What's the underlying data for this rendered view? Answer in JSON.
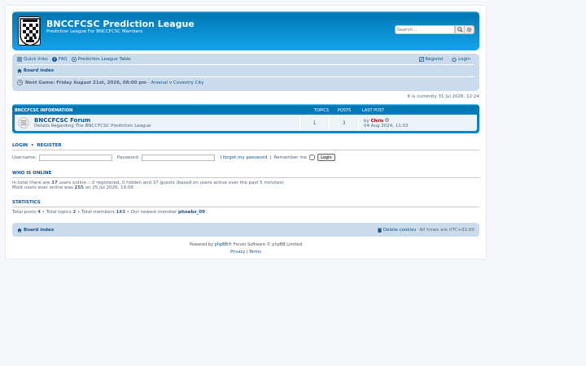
{
  "header": {
    "site_title": "BNCCFCSC Prediction League",
    "site_description": "Prediction League For BNCCFCSC Members",
    "search_placeholder": "Search…"
  },
  "nav": {
    "quick_links": "Quick links",
    "faq": "FAQ",
    "league_table": "Prediction League Table",
    "register": "Register",
    "login": "Login",
    "board_index": "Board index",
    "next_game_label": "Next Game: Friday August 21st, 2026, 08:00 pm",
    "next_game_sep": " - ",
    "next_game_match": "Arsenal v Coventry City"
  },
  "time_line": "It is currently 31 Jul 2026, 12:24",
  "forum_table": {
    "headers": [
      "BNCCFCSC INFORMATION",
      "TOPICS",
      "POSTS",
      "LAST POST"
    ],
    "row": {
      "title": "BNCCFCSC Forum",
      "description": "Details Regarding The BNCCFCSC Prediction League",
      "topics": "1",
      "posts": "3",
      "by": "by",
      "last_author": "Chris",
      "last_date": "04 Aug 2024, 11:02"
    }
  },
  "login": {
    "title_login": "LOGIN",
    "bullet": "•",
    "title_register": "REGISTER",
    "username_label": "Username:",
    "password_label": "Password:",
    "forgot": "I forgot my password",
    "divider": "|",
    "remember": "Remember me",
    "button": "Login"
  },
  "who_online": {
    "title": "WHO IS ONLINE",
    "line1_pre": "In total there are ",
    "line1_count": "37",
    "line1_post": " users online :: 0 registered, 0 hidden and 37 guests (based on users active over the past 5 minutes)",
    "line2_pre": "Most users ever online was ",
    "line2_count": "255",
    "line2_post": " on 25 Jul 2026, 19:06"
  },
  "statistics": {
    "title": "STATISTICS",
    "posts_label": "Total posts ",
    "posts": "4",
    "topics_label": " • Total topics ",
    "topics": "2",
    "members_label": " • Total members ",
    "members": "143",
    "newest_label": " • Our newest member ",
    "newest": "phoebz_09"
  },
  "footer": {
    "board_index": "Board index",
    "delete_cookies": "Delete cookies",
    "timezone": "All times are UTC+01:00",
    "powered_pre": "Powered by ",
    "phpbb": "phpBB",
    "powered_post": "® Forum Software © phpBB Limited",
    "privacy": "Privacy",
    "sep": " | ",
    "terms": "Terms"
  },
  "colors": {
    "header_blue": "#12a3eb",
    "nav_bg": "#cadceb",
    "link": "#105289"
  }
}
